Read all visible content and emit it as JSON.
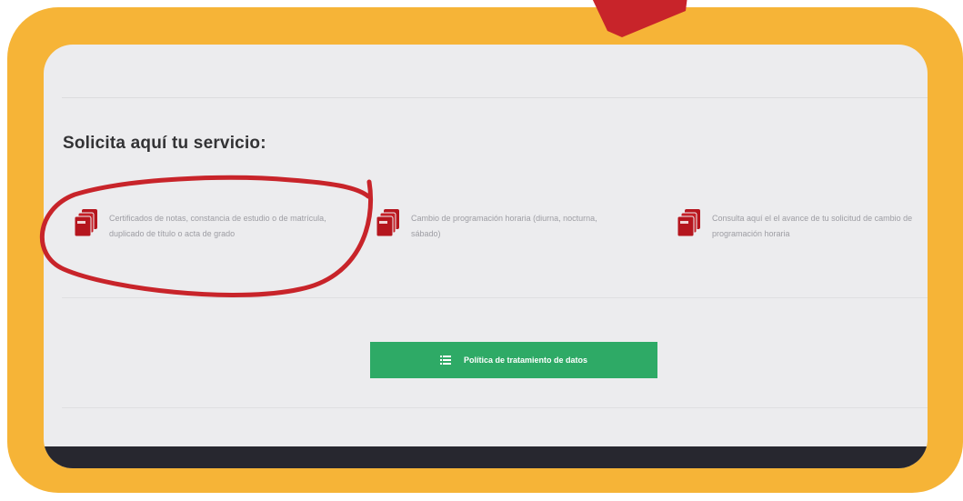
{
  "page": {
    "heading": "Solicita aquí tu servicio:"
  },
  "services": [
    {
      "icon": "document-stack-icon",
      "label": "Certificados de notas, constancia de estudio o de matrícula, duplicado de título o acta de grado"
    },
    {
      "icon": "document-stack-icon",
      "label": "Cambio de programación horaria (diurna, nocturna, sábado)"
    },
    {
      "icon": "document-stack-icon",
      "label": "Consulta aquí el el avance de tu solicitud de cambio de programación horaria"
    }
  ],
  "policy_button": {
    "icon": "list-icon",
    "label": "Política de tratamiento de datos"
  },
  "colors": {
    "frame": "#f6b437",
    "screen": "#ececee",
    "service_icon": "#b5161e",
    "button": "#2eaa66",
    "annotation": "#c8242a",
    "footer": "#27272f"
  },
  "annotation": {
    "marks": [
      "arrow-tip",
      "circle-around-first-service"
    ]
  }
}
